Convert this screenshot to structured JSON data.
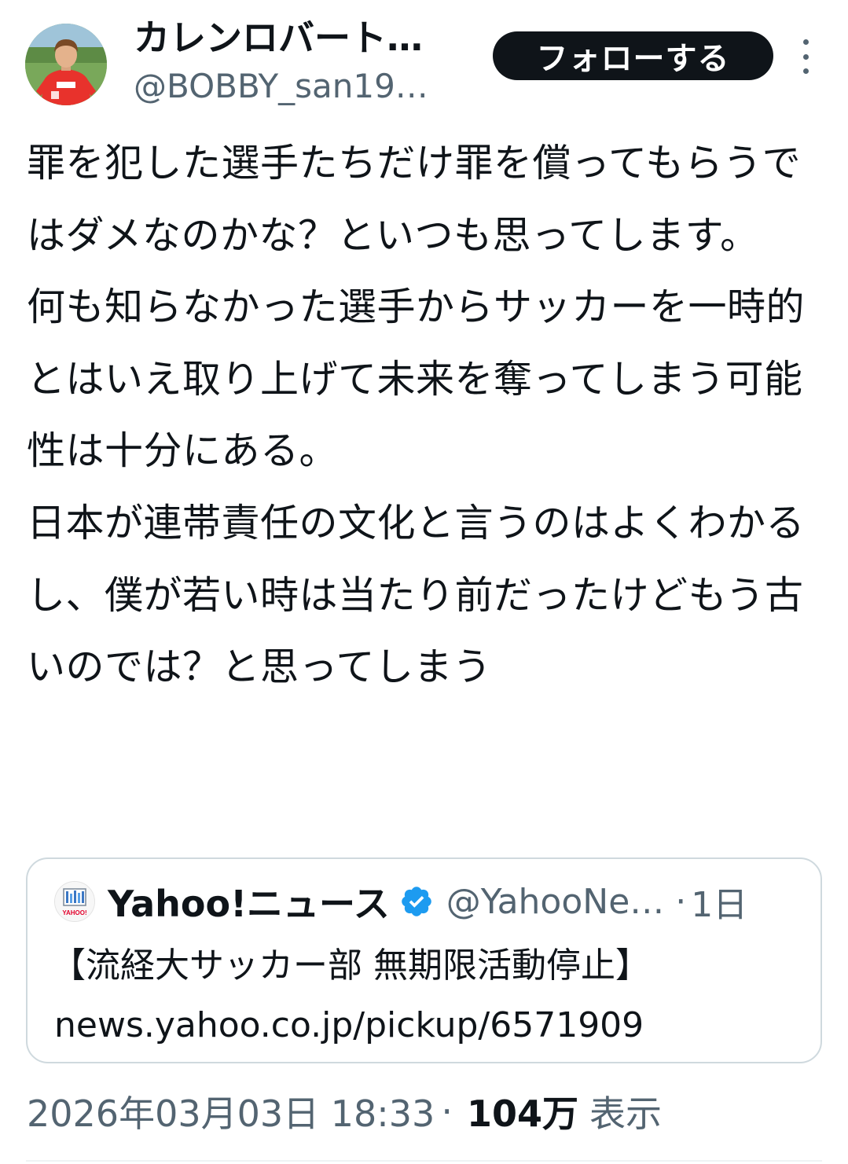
{
  "author": {
    "display_name": "カレンロバート…",
    "handle": "@BOBBY_san19…",
    "follow_label": "フォローする",
    "avatar_icon": "player-photo-avatar",
    "more_icon": "more-vertical-icon"
  },
  "tweet": {
    "text": "罪を犯した選手たちだけ罪を償ってもらうではダメなのかな？といつも思ってします。\n何も知らなかった選手からサッカーを一時的とはいえ取り上げて未来を奪ってしまう可能性は十分にある。\n日本が連帯責任の文化と言うのはよくわかるし、僕が若い時は当たり前だったけどもう古いのでは？と思ってしまう"
  },
  "quote": {
    "name": "Yahoo!ニュース",
    "handle": "@YahooNe…",
    "dot": "·",
    "time": "1日",
    "headline": "【流経大サッカー部 無期限活動停止】",
    "link": "news.yahoo.co.jp/pickup/6571909",
    "verified_color": "#1d9bf0",
    "avatar_icon": "yahoo-news-logo-icon",
    "logo_text": "YAHOO!"
  },
  "meta": {
    "datetime": "2026年03月03日 18:33",
    "separator": "·",
    "views_count": "104万",
    "views_label": "表示"
  },
  "colors": {
    "text_primary": "#0f1419",
    "text_secondary": "#536471",
    "border": "#cfd9de",
    "follow_bg": "#0f1419",
    "jersey_red": "#e8322c"
  }
}
